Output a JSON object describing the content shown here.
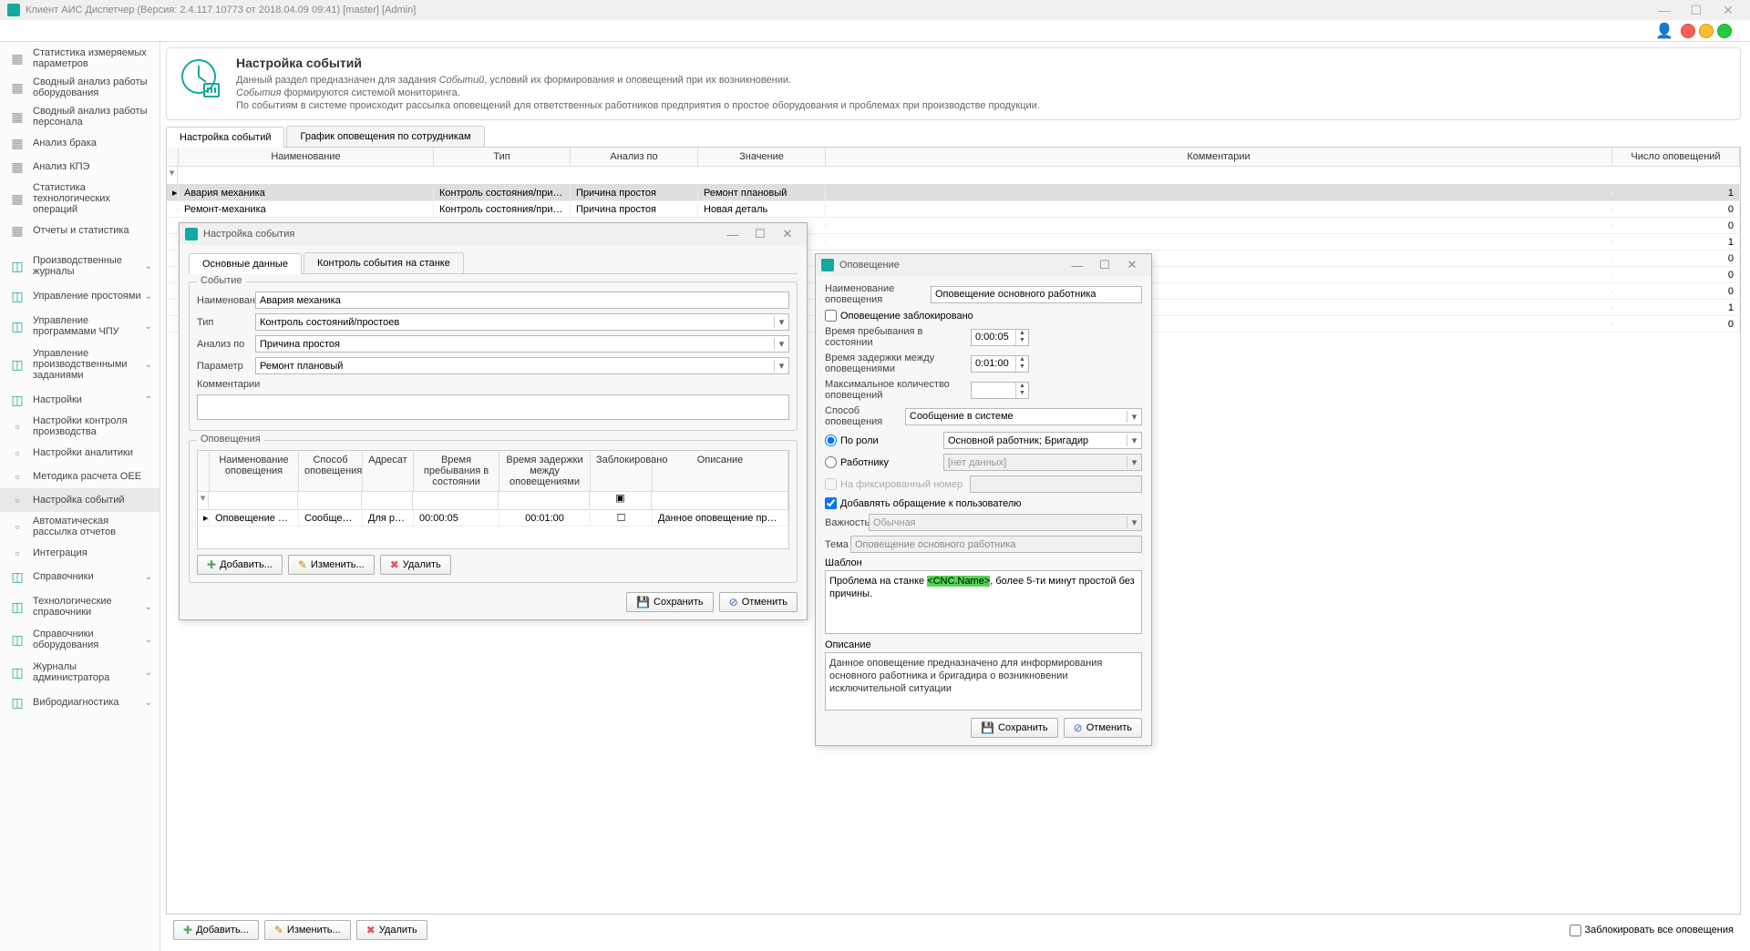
{
  "titlebar": "Клиент АИС Диспетчер (Версия: 2.4.117.10773 от 2018.04.09 09:41) [master]  [Admin]",
  "sidebar": {
    "top": [
      "Статистика измеряемых параметров",
      "Сводный анализ работы оборудования",
      "Сводный анализ работы персонала",
      "Анализ брака",
      "Анализ КПЭ",
      "Статистика технологических операций",
      "Отчеты и статистика"
    ],
    "groups": [
      {
        "label": "Производственные журналы",
        "expandable": true
      },
      {
        "label": "Управление простоями",
        "expandable": true
      },
      {
        "label": "Управление программами ЧПУ",
        "expandable": true
      },
      {
        "label": "Управление производственными заданиями",
        "expandable": true
      },
      {
        "label": "Настройки",
        "expandable": true,
        "expanded": true,
        "children": [
          "Настройки контроля производства",
          "Настройки аналитики",
          "Методика расчета OEE",
          "Настройка событий",
          "Автоматическая рассылка отчетов",
          "Интеграция"
        ]
      },
      {
        "label": "Справочники",
        "expandable": true
      },
      {
        "label": "Технологические справочники",
        "expandable": true
      },
      {
        "label": "Справочники оборудования",
        "expandable": true
      },
      {
        "label": "Журналы администратора",
        "expandable": true
      },
      {
        "label": "Вибродиагностика",
        "expandable": true
      }
    ]
  },
  "header": {
    "title": "Настройка событий",
    "line1a": "Данный раздел предназначен для задания ",
    "line1b": "Событий",
    "line1c": ", условий их формирования и оповещений при их возникновении.",
    "line2a": "События",
    "line2b": " формируются системой мониторинга.",
    "line3": "По событиям в системе происходит рассылка оповещений для ответственных работников предприятия о простое оборудования и проблемах при производстве продукции."
  },
  "mainTabs": [
    "Настройка событий",
    "График оповещения по сотрудникам"
  ],
  "mainGrid": {
    "cols": [
      "Наименование",
      "Тип",
      "Анализ по",
      "Значение",
      "Комментарии",
      "Число оповещений"
    ],
    "rows": [
      {
        "name": "Авария механика",
        "type": "Контроль состояния/причины п...",
        "analysis": "Причина простоя",
        "value": "Ремонт плановый",
        "comment": "",
        "count": "1",
        "sel": true
      },
      {
        "name": "Ремонт-механика",
        "type": "Контроль состояния/причины п...",
        "analysis": "Причина простоя",
        "value": "Новая деталь",
        "comment": "",
        "count": "0"
      },
      {
        "count": "0"
      },
      {
        "count": "1"
      },
      {
        "count": "0"
      },
      {
        "count": "0"
      },
      {
        "count": "0"
      },
      {
        "count": "1"
      },
      {
        "count": "0"
      }
    ]
  },
  "footer": {
    "add": "Добавить...",
    "edit": "Изменить...",
    "del": "Удалить",
    "block": "Заблокировать все оповещения"
  },
  "dlg1": {
    "title": "Настройка события",
    "tabs": [
      "Основные данные",
      "Контроль события на станке"
    ],
    "fs_event": "Событие",
    "f_name": "Наименование",
    "v_name": "Авария механика",
    "f_type": "Тип",
    "v_type": "Контроль состояний/простоев",
    "f_analysis": "Анализ по",
    "v_analysis": "Причина простоя",
    "f_param": "Параметр",
    "v_param": "Ремонт плановый",
    "f_comment": "Комментарии",
    "fs_notif": "Оповещения",
    "ncols": [
      "Наименование оповещения",
      "Способ оповещения",
      "Адресат",
      "Время пребывания в состоянии",
      "Время задержки между оповещениями",
      "Заблокировано",
      "Описание"
    ],
    "nrow": {
      "name": "Оповещение основ...",
      "method": "Сообщение в ...",
      "addr": "Для рол...",
      "stay": "00:00:05",
      "delay": "00:01:00",
      "desc": "Данное оповещение предназн..."
    },
    "add": "Добавить...",
    "edit": "Изменить...",
    "del": "Удалить",
    "save": "Сохранить",
    "cancel": "Отменить"
  },
  "dlg2": {
    "title": "Оповещение",
    "f_name": "Наименование оповещения",
    "v_name": "Оповещение основного работника",
    "f_blocked": "Оповещение заблокировано",
    "f_stay": "Время пребывания в состоянии",
    "v_stay": "0:00:05",
    "f_delay": "Время задержки между оповещениями",
    "v_delay": "0:01:00",
    "f_max": "Максимальное количество оповещений",
    "f_method": "Способ оповещения",
    "v_method": "Сообщение в системе",
    "r_role": "По роли",
    "v_role": "Основной работник; Бригадир",
    "r_emp": "Работнику",
    "v_emp": "[нет данных]",
    "f_fixed": "На фиксированный номер",
    "f_addusr": "Добавлять обращение к пользователю",
    "f_prio": "Важность",
    "v_prio": "Обычная",
    "f_subj": "Тема",
    "v_subj": "Оповещение основного работника",
    "f_tpl": "Шаблон",
    "tpl_a": "Проблема на станке ",
    "tpl_tag": "<CNC.Name>",
    "tpl_b": ", более 5-ти минут простой без причины.",
    "f_desc": "Описание",
    "v_desc": "Данное оповещение предназначено для информирования основного работника и бригадира о возникновении исключительной ситуации",
    "save": "Сохранить",
    "cancel": "Отменить"
  }
}
